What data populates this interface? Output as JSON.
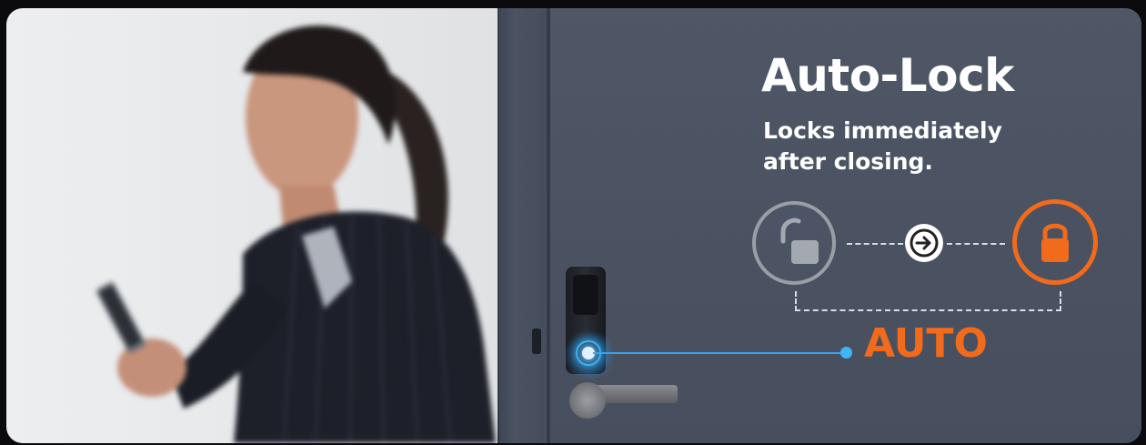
{
  "banner": {
    "title": "Auto-Lock",
    "subtitle": "Locks immediately after closing.",
    "auto_label": "AUTO"
  },
  "diagram": {
    "start_icon": "unlocked-padlock-icon",
    "transition_icon": "arrow-right-icon",
    "end_icon": "locked-padlock-icon"
  },
  "colors": {
    "accent_orange": "#f26a1b",
    "sensor_blue": "#3aa3e6",
    "door_gray": "#4a5262",
    "wall_white": "#e8eaec"
  },
  "scene": {
    "photo": "woman-walking-with-phone",
    "device": "smart-lever-lock"
  }
}
